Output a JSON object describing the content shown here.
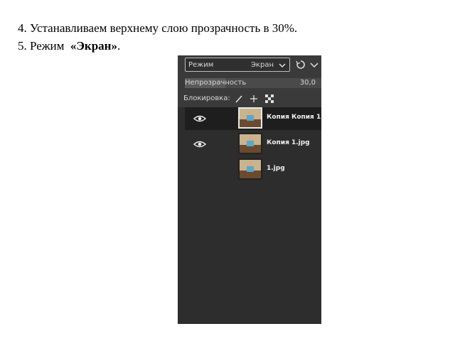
{
  "document": {
    "line1": "4. Устанавливаем верхнему слою прозрачность в 30%.",
    "line2_prefix": "5. Режим  ",
    "line2_bold": "«Экран»",
    "line2_suffix": "."
  },
  "panel": {
    "mode_label": "Режим",
    "mode_value": "Экран",
    "opacity_label": "Непрозрачность",
    "opacity_value": "30,0",
    "opacity_percent": 30,
    "lock_label": "Блокировка:",
    "layers": [
      {
        "name": "Копия Копия 1",
        "visible": true,
        "selected": true
      },
      {
        "name": "Копия 1.jpg",
        "visible": true,
        "selected": false
      },
      {
        "name": "1.jpg",
        "visible": false,
        "selected": false
      }
    ],
    "colors": {
      "panel_bg": "#3a3a3a",
      "list_bg": "#2d2d2d",
      "selected_row": "#1e1e1e"
    }
  }
}
